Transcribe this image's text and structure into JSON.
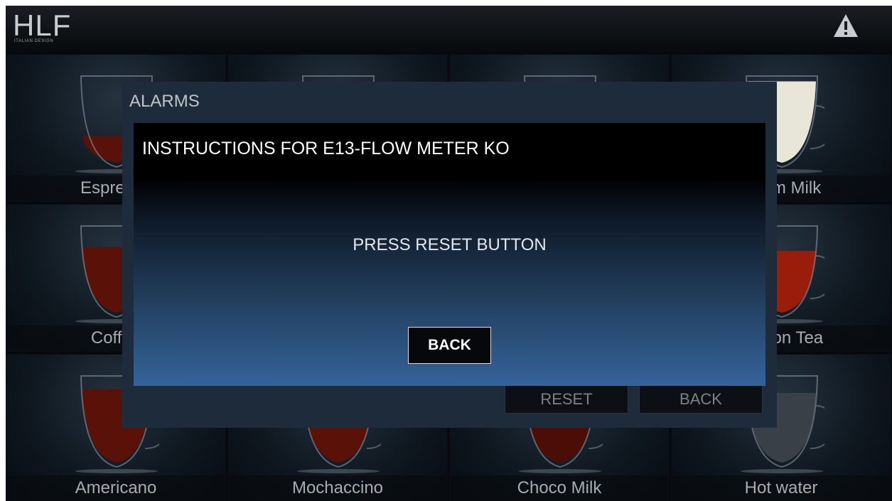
{
  "header": {
    "logo_text": "HLF",
    "logo_sub": "ITALIAN DESIGN",
    "alarm_icon": "warning-triangle-icon"
  },
  "tiles": [
    {
      "label": "Espresso",
      "drink": "espresso"
    },
    {
      "label": "",
      "drink": "cappuccino"
    },
    {
      "label": "",
      "drink": "latte"
    },
    {
      "label": "Warm Milk",
      "drink": "warm-milk"
    },
    {
      "label": "Coffee",
      "drink": "coffee"
    },
    {
      "label": "",
      "drink": "cafe-creme"
    },
    {
      "label": "",
      "drink": "chocolate"
    },
    {
      "label": "Lemon Tea",
      "drink": "lemon-tea"
    },
    {
      "label": "Americano",
      "drink": "americano"
    },
    {
      "label": "Mochaccino",
      "drink": "mochaccino"
    },
    {
      "label": "Choco Milk",
      "drink": "choco-milk"
    },
    {
      "label": "Hot water",
      "drink": "hot-water"
    }
  ],
  "alarms_panel": {
    "title": "ALARMS",
    "reset_label": "RESET",
    "back_label": "BACK"
  },
  "dialog": {
    "heading": "INSTRUCTIONS FOR E13-FLOW METER KO",
    "message": "PRESS RESET BUTTON",
    "back_label": "BACK"
  },
  "colors": {
    "screen_bg": "#05080c",
    "dialog_gradient_bottom": "#34639a",
    "coffee_liquid": "#5a1208",
    "tea_liquid": "#9a1c0a",
    "milk": "#e8e6d8"
  }
}
